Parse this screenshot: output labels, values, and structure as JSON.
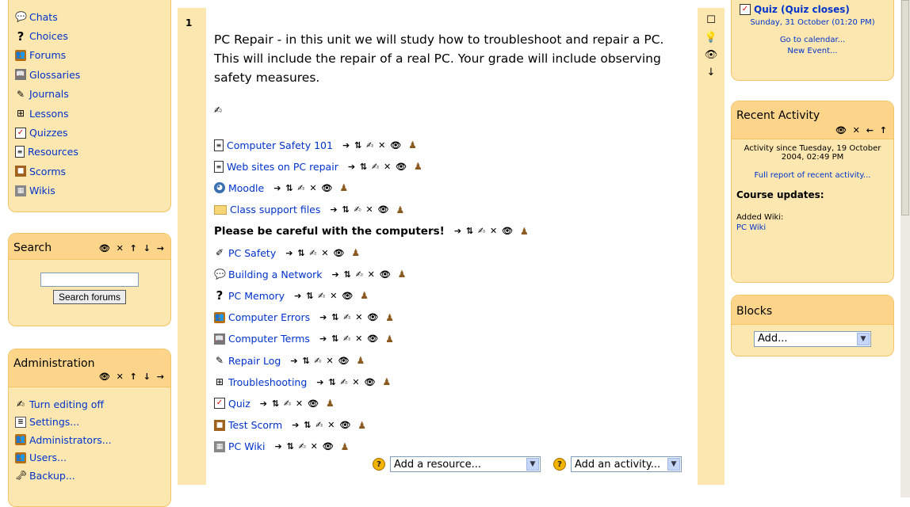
{
  "left_activities": {
    "items": [
      {
        "icon": "chat-icon",
        "glyph": "💬",
        "label": "Chats"
      },
      {
        "icon": "choice-icon",
        "glyph": "?",
        "label": "Choices"
      },
      {
        "icon": "forum-icon",
        "glyph": "👥",
        "label": "Forums"
      },
      {
        "icon": "glossary-icon",
        "glyph": "📖",
        "label": "Glossaries"
      },
      {
        "icon": "journal-icon",
        "glyph": "✎",
        "label": "Journals"
      },
      {
        "icon": "lesson-icon",
        "glyph": "⊞",
        "label": "Lessons"
      },
      {
        "icon": "quiz-icon",
        "glyph": "✓",
        "label": "Quizzes"
      },
      {
        "icon": "resource-icon",
        "glyph": "≡",
        "label": "Resources"
      },
      {
        "icon": "scorm-icon",
        "glyph": "■",
        "label": "Scorms"
      },
      {
        "icon": "wiki-icon",
        "glyph": "▦",
        "label": "Wikis"
      }
    ]
  },
  "search": {
    "title": "Search",
    "controls": "👁 ✕ ↑ ↓ →",
    "button": "Search forums",
    "value": ""
  },
  "admin": {
    "title": "Administration",
    "controls": "👁 ✕ ↑ ↓ →",
    "items": [
      {
        "icon": "edit-icon",
        "glyph": "✍",
        "label": "Turn editing off"
      },
      {
        "icon": "settings-icon",
        "glyph": "≣",
        "label": "Settings..."
      },
      {
        "icon": "admin-icon",
        "glyph": "👥",
        "label": "Administrators..."
      },
      {
        "icon": "users-icon",
        "glyph": "👥",
        "label": "Users..."
      },
      {
        "icon": "backup-icon",
        "glyph": "🗝",
        "label": "Backup..."
      }
    ]
  },
  "section": {
    "number": "1",
    "summary": "PC Repair - in this unit we will study how to troubleshoot and repair a PC. This will include the repair of a real PC. Your grade will include observing safety measures.",
    "activity_controls": "➔ ⇅ ✍ ✕ 👁",
    "activities": [
      {
        "icon": "resource-icon",
        "glyph": "≡",
        "label": "Computer Safety 101",
        "kind": "link"
      },
      {
        "icon": "resource-icon",
        "glyph": "≡",
        "label": "Web sites on PC repair",
        "kind": "link"
      },
      {
        "icon": "globe-icon",
        "glyph": "◕",
        "label": "Moodle",
        "kind": "link"
      },
      {
        "icon": "folder-icon",
        "glyph": "",
        "label": "Class support files",
        "kind": "link"
      },
      {
        "icon": "",
        "glyph": "",
        "label": "Please be careful with the computers!",
        "kind": "label"
      },
      {
        "icon": "workshop-icon",
        "glyph": "✐",
        "label": "PC Safety",
        "kind": "link"
      },
      {
        "icon": "chat-icon",
        "glyph": "💬",
        "label": "Building a Network",
        "kind": "link"
      },
      {
        "icon": "choice-icon",
        "glyph": "?",
        "label": "PC Memory",
        "kind": "link"
      },
      {
        "icon": "forum-icon",
        "glyph": "👥",
        "label": "Computer Errors",
        "kind": "link"
      },
      {
        "icon": "glossary-icon",
        "glyph": "📖",
        "label": "Computer Terms",
        "kind": "link"
      },
      {
        "icon": "journal-icon",
        "glyph": "✎",
        "label": "Repair Log",
        "kind": "link"
      },
      {
        "icon": "lesson-icon",
        "glyph": "⊞",
        "label": "Troubleshooting",
        "kind": "link"
      },
      {
        "icon": "quiz-icon",
        "glyph": "✓",
        "label": "Quiz",
        "kind": "link"
      },
      {
        "icon": "scorm-icon",
        "glyph": "■",
        "label": "Test Scorm",
        "kind": "link"
      },
      {
        "icon": "wiki-icon",
        "glyph": "▦",
        "label": "PC Wiki",
        "kind": "link"
      }
    ],
    "add_resource": "Add a resource...",
    "add_activity": "Add an activity..."
  },
  "calendar": {
    "event": "Quiz (Quiz closes)",
    "date": "Sunday, 31 October (01:20 PM)",
    "goto": "Go to calendar...",
    "new_event": "New Event..."
  },
  "recent": {
    "title": "Recent Activity",
    "controls": "👁 ✕ ← ↑",
    "since": "Activity since Tuesday, 19 October 2004, 02:49 PM",
    "full_report": "Full report of recent activity...",
    "updates_title": "Course updates:",
    "added": "Added Wiki:",
    "added_link": "PC Wiki"
  },
  "blocks": {
    "title": "Blocks",
    "select": "Add..."
  }
}
